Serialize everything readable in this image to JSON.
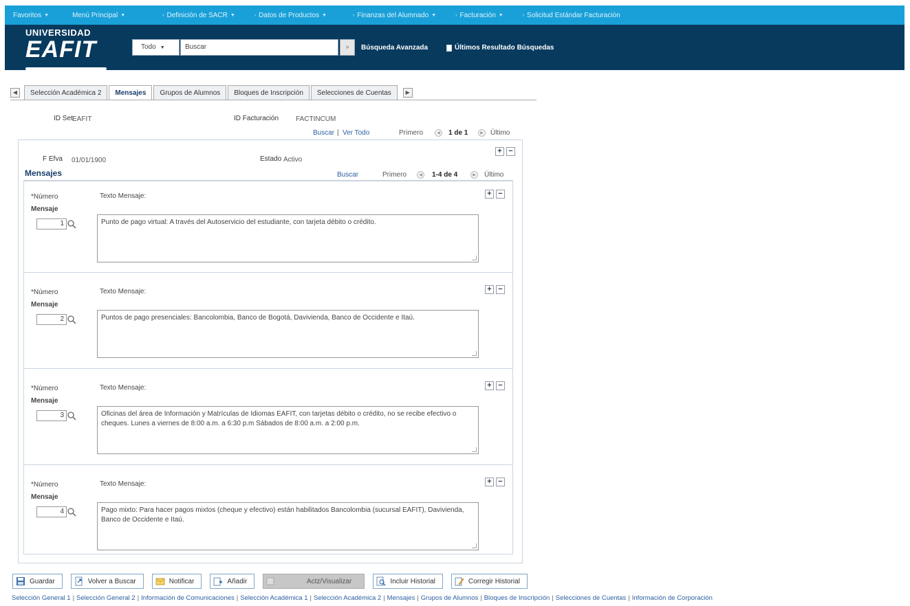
{
  "topnav": {
    "items": [
      {
        "label": "Favoritos"
      },
      {
        "label": "Menú Principal"
      },
      {
        "label": "Definición de SACR"
      },
      {
        "label": "Datos de Productos"
      },
      {
        "label": "Finanzas del Alumnado"
      },
      {
        "label": "Facturación"
      },
      {
        "label": "Solicitud Estándar Facturación"
      }
    ]
  },
  "header": {
    "logo_line1": "UNIVERSIDAD",
    "logo_line2": "EAFIT",
    "search_scope": "Todo",
    "search_value": "Buscar",
    "advanced_search": "Búsqueda Avanzada",
    "last_results": "Últimos Resultado Búsquedas"
  },
  "tabs": [
    {
      "label": "Selección Académica 2",
      "active": false
    },
    {
      "label": "Mensajes",
      "active": true
    },
    {
      "label": "Grupos de Alumnos",
      "active": false
    },
    {
      "label": "Bloques de Inscripción",
      "active": false
    },
    {
      "label": "Selecciones de Cuentas",
      "active": false
    }
  ],
  "info": {
    "setid_label": "ID Set",
    "setid_value": "EAFIT",
    "billing_label": "ID Facturación",
    "billing_value": "FACTINCUM"
  },
  "outer_nav": {
    "search_link": "Buscar",
    "separator": "|",
    "view_all": "Ver Todo",
    "first": "Primero",
    "count": "1 de 1",
    "last": "Último"
  },
  "effdt": {
    "label": "F Efva",
    "value": "01/01/1900",
    "status_label": "Estado",
    "status_value": "Activo"
  },
  "messages": {
    "title": "Mensajes",
    "search_link": "Buscar",
    "first": "Primero",
    "count": "1-4 de 4",
    "last": "Último",
    "num_label_1": "*Número",
    "num_label_2": "Mensaje",
    "text_label": "Texto Mensaje:",
    "rows": [
      {
        "number": "1",
        "text": "Punto de pago virtual: A través del Autoservicio del estudiante, con tarjeta débito o crédito."
      },
      {
        "number": "2",
        "text": "Puntos de pago presenciales: Bancolombia, Banco de Bogotá, Davivienda, Banco de Occidente e Itaú."
      },
      {
        "number": "3",
        "text": "Oficinas del área de Información y Matrículas de Idiomas EAFIT, con tarjetas débito o crédito, no se recibe efectivo o cheques. Lunes a viernes de 8:00 a.m. a 6:30 p.m Sábados de 8:00 a.m. a 2:00 p.m."
      },
      {
        "number": "4",
        "text": "Pago mixto: Para hacer pagos mixtos (cheque y efectivo) están habilitados Bancolombia (sucursal EAFIT), Davivienda, Banco de Occidente e Itaú."
      }
    ]
  },
  "toolbar": {
    "save": "Guardar",
    "back": "Volver a Buscar",
    "notify": "Notificar",
    "add": "Añadir",
    "update": "Actz/Visualizar",
    "include_history": "Incluir Historial",
    "correct_history": "Corregir Historial"
  },
  "footer_links": [
    "Selección General 1",
    "Selección General 2",
    "Información de Comunicaciones",
    "Selección Académica 1",
    "Selección Académica 2",
    "Mensajes",
    "Grupos de Alumnos",
    "Bloques de Inscripción",
    "Selecciones de Cuentas",
    "Información de Corporación"
  ],
  "colors": {
    "topnav_bg": "#1aa0d8",
    "header_bg": "#083a5e",
    "link": "#2b5ea0"
  }
}
